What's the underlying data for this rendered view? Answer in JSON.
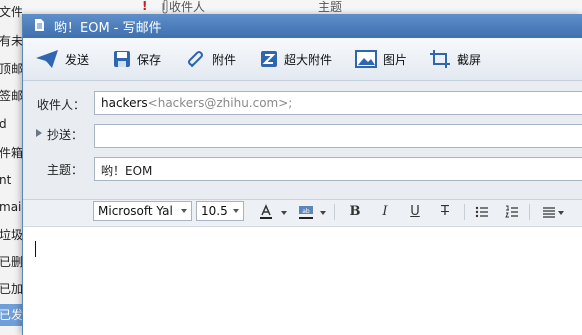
{
  "background": {
    "folders": [
      "文件夹",
      "有未",
      "顶邮",
      "签邮",
      "d",
      "件箱",
      "nt",
      "mai",
      "垃圾",
      "已删",
      "已加",
      "已发"
    ],
    "columns": {
      "recipient": "收件人",
      "subject": "主题"
    },
    "flag": "!"
  },
  "window": {
    "title": "哟！EOM - 写邮件"
  },
  "toolbar": {
    "send": "发送",
    "save": "保存",
    "attach": "附件",
    "big_attach": "超大附件",
    "image": "图片",
    "screenshot": "截屏"
  },
  "fields": {
    "to_label": "收件人：",
    "to_name": "hackers",
    "to_email": "<hackers@zhihu.com>;",
    "cc_label": "抄送：",
    "cc_value": "",
    "subject_label": "主题：",
    "subject_value": "哟！EOM"
  },
  "format": {
    "font": "Microsoft Yal",
    "size": "10.5",
    "bold": "B",
    "italic": "I",
    "underline": "U",
    "strike": "T"
  },
  "colors": {
    "accent": "#3f70ae",
    "titlebar": "#4a7cbc"
  }
}
